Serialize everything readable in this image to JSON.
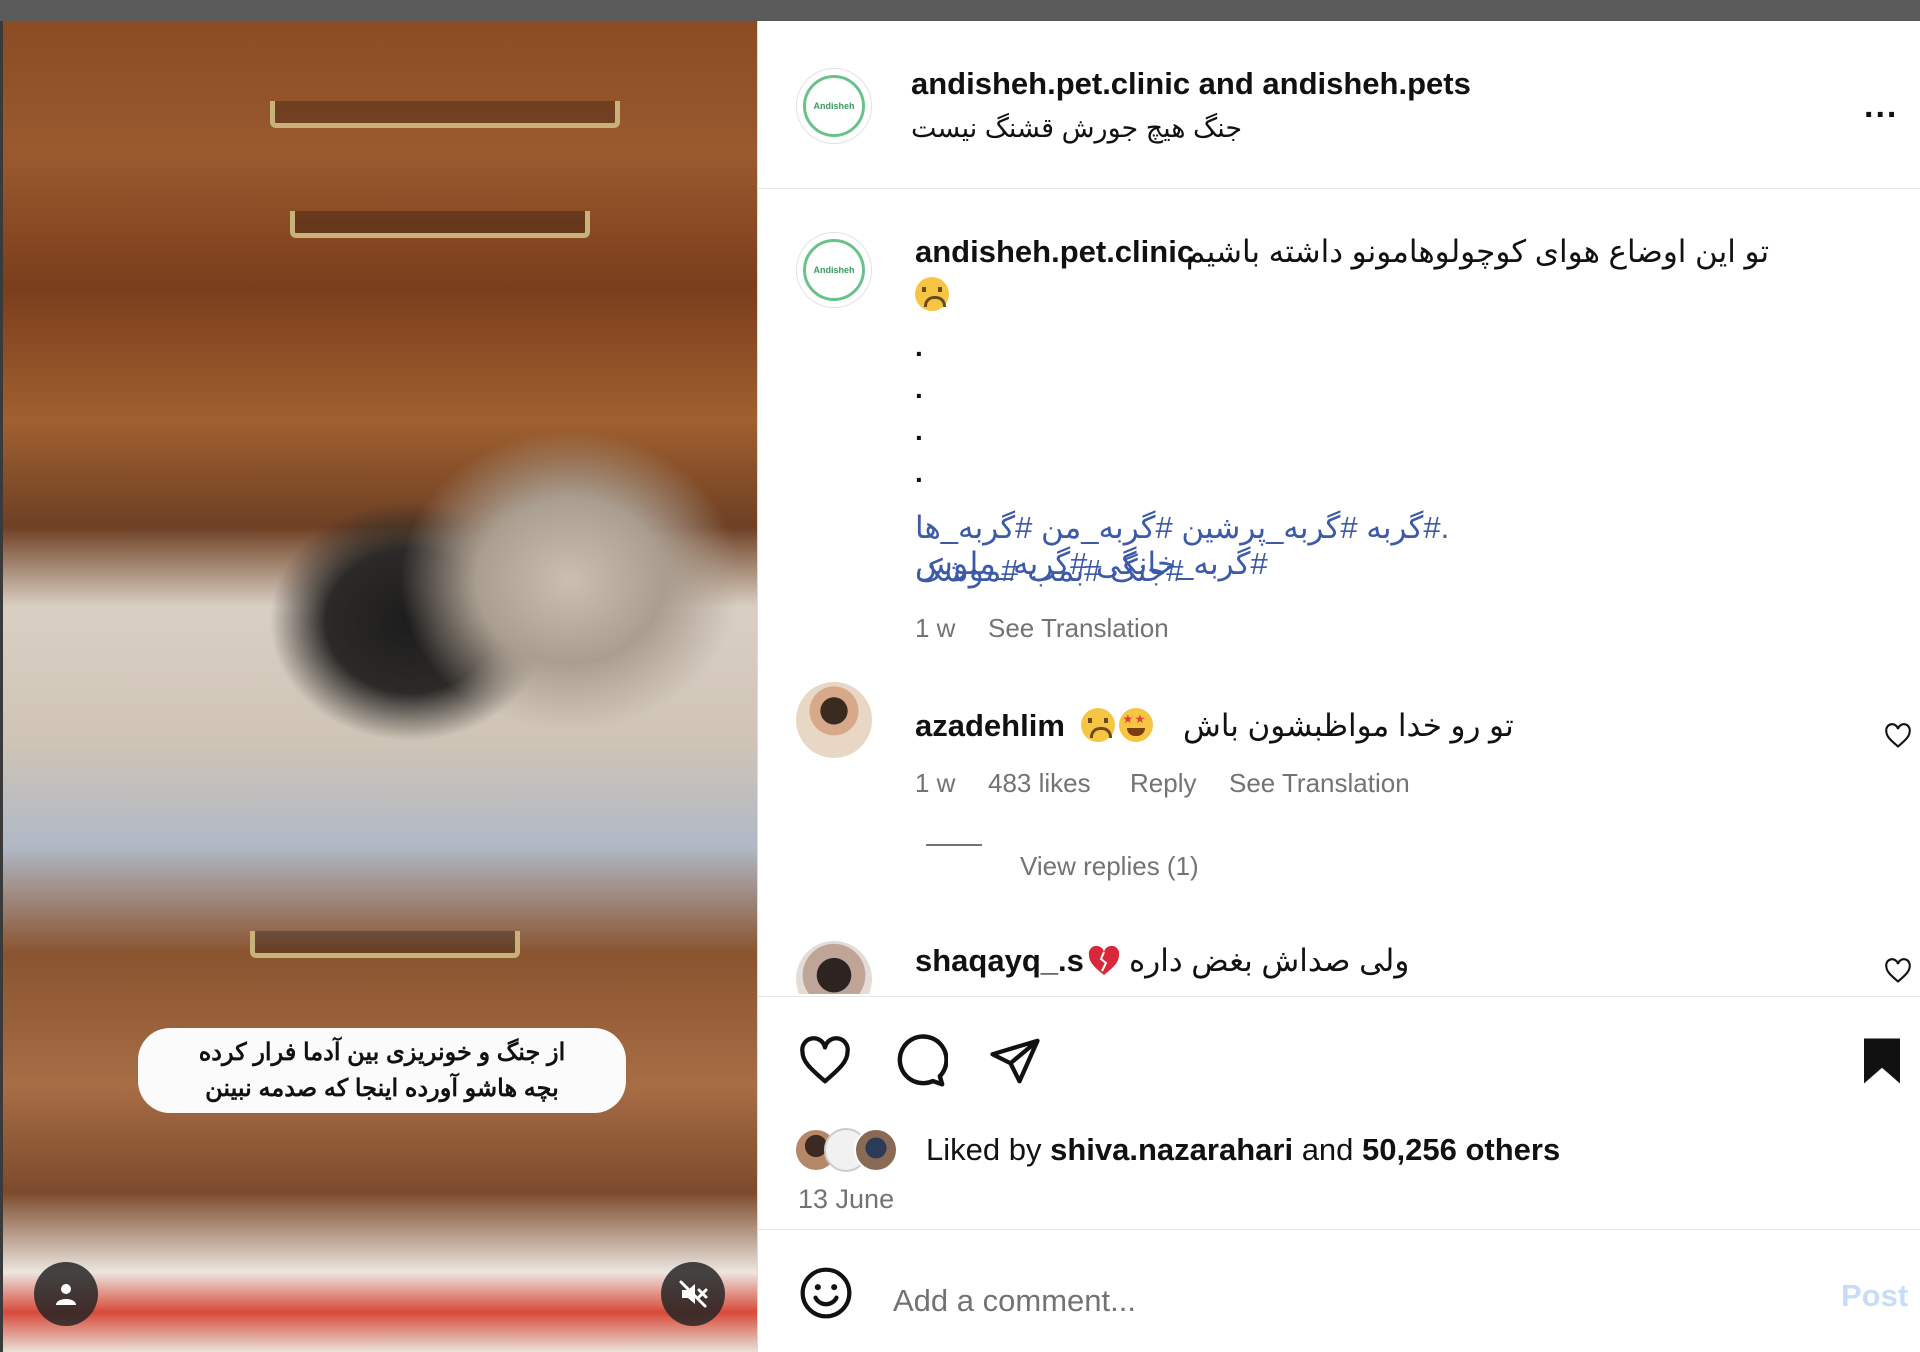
{
  "media": {
    "overlay_line1": "از جنگ و خونریزی بین آدما فرار کرده",
    "overlay_line2": "بچه هاشو آورده اینجا که صدمه نبینن",
    "user_tag_icon": "person-icon",
    "mute_icon": "muted-speaker-icon"
  },
  "header": {
    "usernames": "andisheh.pet.clinic and andisheh.pets",
    "subtitle": "جنگ هیچ جورش قشنگ نیست",
    "more_icon": "more-options-icon",
    "more_label": "..."
  },
  "caption": {
    "username": "andisheh.pet.clinic",
    "text": "تو این اوضاع هوای کوچولوهامونو داشته باشیم",
    "emoji": "sad-face",
    "dots": [
      ".",
      ".",
      ".",
      "."
    ],
    "hashtags_line1": ".#گربه #گربه_پرشین #گربه_من #گربه_ها #گربه_خانگی #گربه_ملوس",
    "hashtags_line2": "#جنگ #بمب #موشک",
    "time": "1 w",
    "see_translation": "See Translation"
  },
  "comments": [
    {
      "username": "azadehlim",
      "text": "تو رو خدا مواظبشون باش",
      "emojis": [
        "sad-face",
        "star-eyes-face"
      ],
      "time": "1 w",
      "likes": "483 likes",
      "reply": "Reply",
      "see_translation": "See Translation",
      "view_replies": "View replies (1)"
    },
    {
      "username": "shaqayq_.s",
      "text": "ولی صداش بغض داره",
      "emojis": [
        "broken-heart"
      ]
    }
  ],
  "actions": {
    "like_icon": "heart-icon",
    "comment_icon": "comment-icon",
    "share_icon": "send-icon",
    "save_icon": "bookmark-icon"
  },
  "likes": {
    "prefix": "Liked by",
    "user": "shiva.nazarahari",
    "and": "and",
    "others": "50,256 others"
  },
  "date": "13 June",
  "add_comment": {
    "placeholder": "Add a comment...",
    "post_label": "Post",
    "emoji_icon": "smiley-icon"
  },
  "colors": {
    "hashtag": "#3c5aa8",
    "muted_text": "#737373",
    "post_disabled": "#c7dcf7",
    "avatar_ring": "#68c28a"
  }
}
